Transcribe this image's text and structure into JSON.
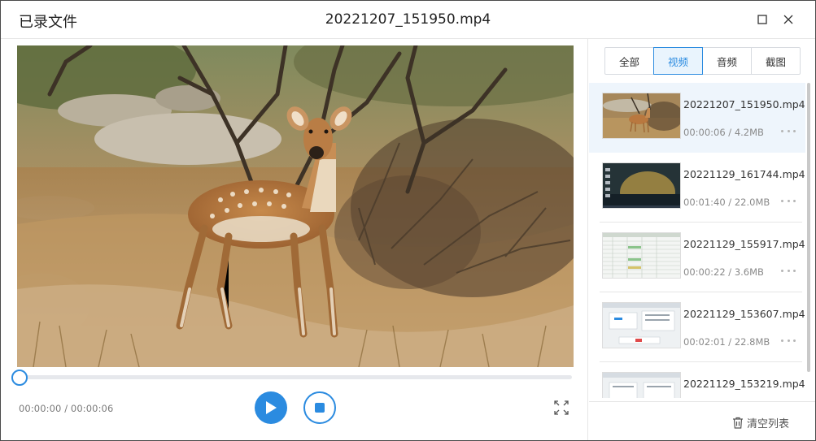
{
  "window": {
    "app_title": "已录文件",
    "file_title": "20221207_151950.mp4",
    "max_icon": "maximize-icon",
    "close_icon": "close-icon"
  },
  "player": {
    "time_text": "00:00:00 / 00:00:06",
    "progress": 0.0,
    "play_icon": "play-icon",
    "stop_icon": "stop-icon",
    "fullscreen_icon": "fullscreen-icon"
  },
  "tabs": [
    {
      "label": "全部",
      "active": false
    },
    {
      "label": "视频",
      "active": true
    },
    {
      "label": "音频",
      "active": false
    },
    {
      "label": "截图",
      "active": false
    }
  ],
  "recordings": [
    {
      "name": "20221207_151950.mp4",
      "meta": "00:00:06 / 4.2MB",
      "selected": true
    },
    {
      "name": "20221129_161744.mp4",
      "meta": "00:01:40 / 22.0MB",
      "selected": false
    },
    {
      "name": "20221129_155917.mp4",
      "meta": "00:00:22 / 3.6MB",
      "selected": false
    },
    {
      "name": "20221129_153607.mp4",
      "meta": "00:02:01 / 22.8MB",
      "selected": false
    },
    {
      "name": "20221129_153219.mp4",
      "meta": "",
      "selected": false
    }
  ],
  "footer": {
    "clear_label": "清空列表",
    "trash_icon": "trash-icon"
  },
  "colors": {
    "accent": "#2b8be0",
    "selected_bg": "#eef5fc"
  }
}
